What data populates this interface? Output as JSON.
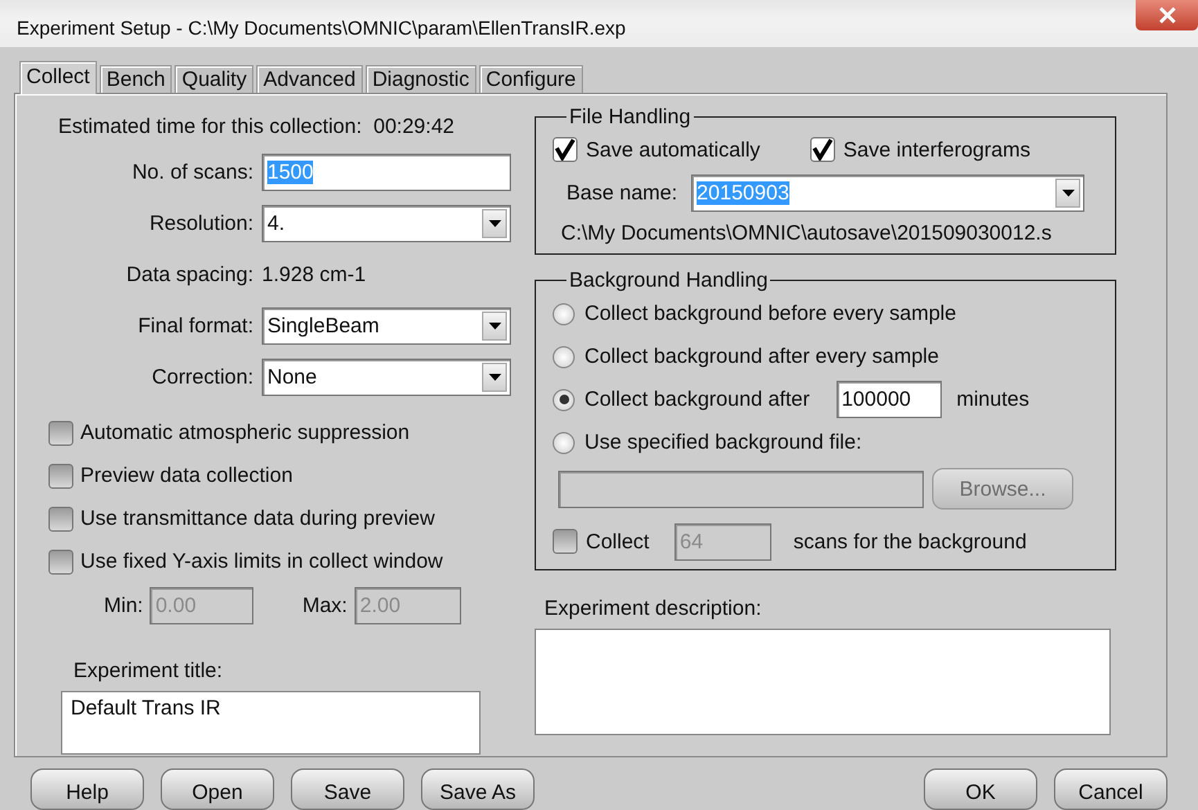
{
  "window": {
    "title": "Experiment Setup - C:\\My Documents\\OMNIC\\param\\EllenTransIR.exp"
  },
  "tabs": [
    {
      "label": "Collect",
      "selected": true
    },
    {
      "label": "Bench",
      "selected": false
    },
    {
      "label": "Quality",
      "selected": false
    },
    {
      "label": "Advanced",
      "selected": false
    },
    {
      "label": "Diagnostic",
      "selected": false
    },
    {
      "label": "Configure",
      "selected": false
    }
  ],
  "collect": {
    "estimated_time": {
      "label": "Estimated time for this collection:",
      "value": "00:29:42"
    },
    "scans": {
      "label": "No. of scans:",
      "value": "1500",
      "highlighted": true
    },
    "resolution": {
      "label": "Resolution:",
      "value": "4."
    },
    "data_spacing": {
      "label": "Data spacing:",
      "value": "1.928 cm-1"
    },
    "final_format": {
      "label": "Final format:",
      "value": "SingleBeam"
    },
    "correction": {
      "label": "Correction:",
      "value": "None"
    },
    "options": [
      {
        "label": "Automatic atmospheric suppression",
        "checked": false
      },
      {
        "label": "Preview data collection",
        "checked": false
      },
      {
        "label": "Use transmittance data during preview",
        "checked": false
      },
      {
        "label": "Use fixed Y-axis limits in collect window",
        "checked": false
      }
    ],
    "min": {
      "label": "Min:",
      "value": "0.00",
      "disabled": true
    },
    "max": {
      "label": "Max:",
      "value": "2.00",
      "disabled": true
    },
    "experiment_title": {
      "label": "Experiment title:",
      "value": "Default Trans IR"
    }
  },
  "file_handling": {
    "title": "File Handling",
    "checks": [
      {
        "label": "Save automatically",
        "checked": true
      },
      {
        "label": "Save interferograms",
        "checked": true
      }
    ],
    "base_name": {
      "label": "Base name:",
      "value": "20150903",
      "highlighted": true
    },
    "path": "C:\\My Documents\\OMNIC\\autosave\\201509030012.s"
  },
  "background_handling": {
    "title": "Background Handling",
    "options": [
      {
        "kind": "plain",
        "label": "Collect background before every sample",
        "selected": false
      },
      {
        "kind": "plain",
        "label": "Collect background after every sample",
        "selected": false
      },
      {
        "kind": "interval",
        "label": "Collect background after",
        "value": "100000",
        "unit": "minutes",
        "selected": true
      },
      {
        "kind": "plain",
        "label": "Use specified background file:",
        "selected": false
      }
    ],
    "file": {
      "disabled": true,
      "button": {
        "label": "Browse...",
        "disabled": true
      }
    },
    "collect": {
      "label": "Collect",
      "checked": false,
      "value": "64",
      "disabled": true,
      "suffix": "scans for the background"
    }
  },
  "experiment_description": {
    "label": "Experiment description:"
  },
  "buttons_left": [
    "Help",
    "Open",
    "Save",
    "Save As"
  ],
  "buttons_right": [
    "OK",
    "Cancel"
  ]
}
